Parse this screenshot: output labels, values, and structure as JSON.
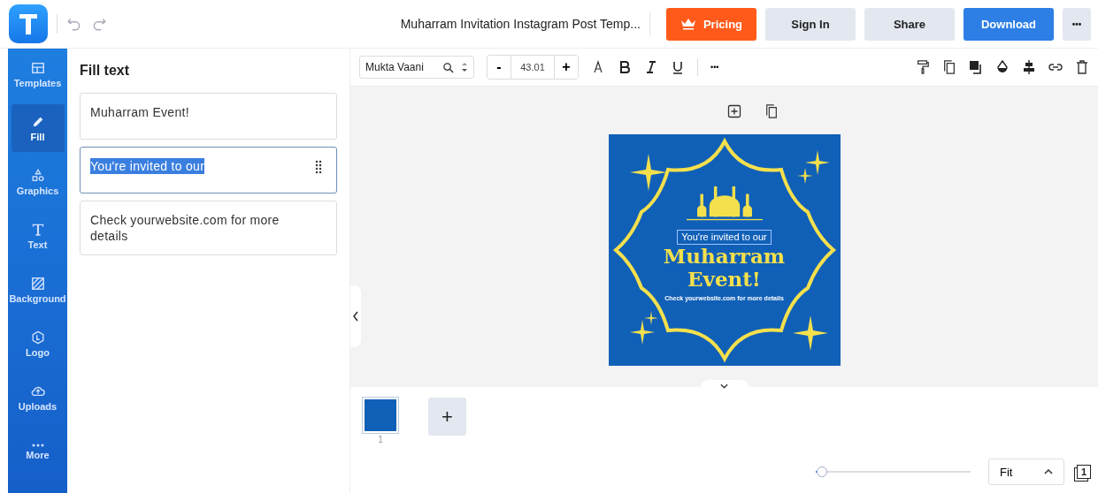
{
  "header": {
    "title": "Muharram Invitation Instagram Post Temp...",
    "buttons": [
      {
        "label": "Pricing",
        "kind": "pricing"
      },
      {
        "label": "Sign In",
        "kind": "plain"
      },
      {
        "label": "Share",
        "kind": "plain"
      },
      {
        "label": "Download",
        "kind": "primary"
      },
      {
        "label": "•••",
        "kind": "more"
      }
    ]
  },
  "sidebar": {
    "items": [
      {
        "label": "Templates",
        "kind": "templates",
        "selected": false
      },
      {
        "label": "Fill",
        "kind": "fill",
        "selected": true
      },
      {
        "label": "Graphics",
        "kind": "graphics",
        "selected": false
      },
      {
        "label": "Text",
        "kind": "text",
        "selected": false
      },
      {
        "label": "Background",
        "kind": "background",
        "selected": false
      },
      {
        "label": "Logo",
        "kind": "logo",
        "selected": false
      },
      {
        "label": "Uploads",
        "kind": "uploads",
        "selected": false
      },
      {
        "label": "More",
        "kind": "more",
        "selected": false
      }
    ]
  },
  "panel": {
    "title": "Fill text",
    "fields": [
      {
        "value": "Muharram Event!",
        "selected": false
      },
      {
        "value": "You're invited to our",
        "selected": true
      },
      {
        "value": "Check yourwebsite.com for more details",
        "selected": false
      }
    ]
  },
  "toolbar": {
    "font": "Mukta Vaani",
    "minus": "-",
    "size": "43.01",
    "plus": "+",
    "more": "•••"
  },
  "canvas": {
    "texts": [
      "You're invited to our",
      "Muharram",
      "Event!",
      "Check yourwebsite.com for more details"
    ]
  },
  "pages": [
    {
      "number": "1",
      "selected": true
    }
  ],
  "add_page": "+",
  "footer": {
    "zoom": {
      "level": 0.04
    },
    "fit": "Fit",
    "page_count": "1"
  }
}
